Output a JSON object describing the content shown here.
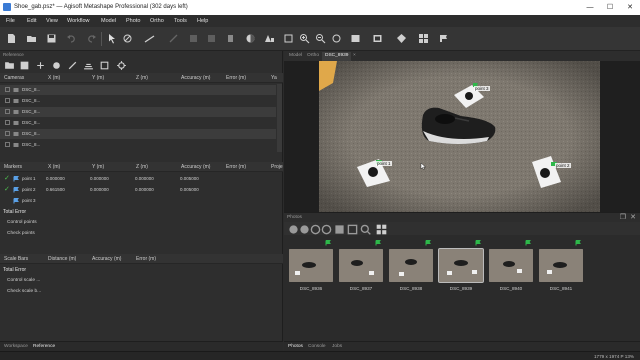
{
  "window": {
    "title": "Shoe_gab.psz* — Agisoft Metashape Professional (302 days left)",
    "minimize": "—",
    "maximize": "☐",
    "close": "✕"
  },
  "menu": [
    "File",
    "Edit",
    "View",
    "Workflow",
    "Model",
    "Photo",
    "Ortho",
    "Tools",
    "Help"
  ],
  "reference_panel": {
    "title": "Reference",
    "cameras_table": {
      "headers": [
        "Cameras",
        "X (m)",
        "Y (m)",
        "Z (m)",
        "Accuracy (m)",
        "Error (m)",
        "Ya"
      ],
      "rows": [
        "DSC_8...",
        "DSC_8...",
        "DSC_8...",
        "DSC_8...",
        "DSC_8...",
        "DSC_8..."
      ]
    },
    "markers_table": {
      "headers": [
        "Markers",
        "X (m)",
        "Y (m)",
        "Z (m)",
        "Accuracy (m)",
        "Error (m)",
        "Proje"
      ],
      "rows": [
        {
          "name": "point 1",
          "x": "0.000000",
          "y": "0.000000",
          "z": "0.000000",
          "accuracy": "0.005000",
          "checked": true
        },
        {
          "name": "point 2",
          "x": "0.661500",
          "y": "0.000000",
          "z": "0.000000",
          "accuracy": "0.005000",
          "checked": true
        },
        {
          "name": "point 3",
          "x": "",
          "y": "",
          "z": "",
          "accuracy": "",
          "checked": false
        }
      ],
      "total_error": "Total Error",
      "control_points": "Control points",
      "check_points": "Check points"
    },
    "scalebars_table": {
      "headers": [
        "Scale Bars",
        "Distance (m)",
        "Accuracy (m)",
        "Error (m)"
      ],
      "total_error": "Total Error",
      "control_scale": "Control scale ...",
      "check_scale": "Check scale b..."
    },
    "tabs": [
      "Workspace",
      "Reference"
    ],
    "active_tab": "Reference"
  },
  "viewport": {
    "tabs": [
      "Model",
      "Ortho",
      "DSC_8939"
    ],
    "active_tab": "DSC_8939",
    "close_icon": "×",
    "markers": [
      "point 3",
      "point 1",
      "point 2"
    ],
    "colors": {
      "carpet": "#7e786f",
      "shoe": "#1e1e1e",
      "marker_flag": "#2eb84a"
    }
  },
  "photos": {
    "title": "Photos",
    "items": [
      "DSC_8936",
      "DSC_8937",
      "DSC_8938",
      "DSC_8939",
      "DSC_8940",
      "DSC_8941"
    ],
    "selected": "DSC_8939",
    "tabs": [
      "Photos",
      "Console",
      "Jobs"
    ],
    "active_tab": "Photos"
  },
  "status": "1779 x 1974 P 13%"
}
